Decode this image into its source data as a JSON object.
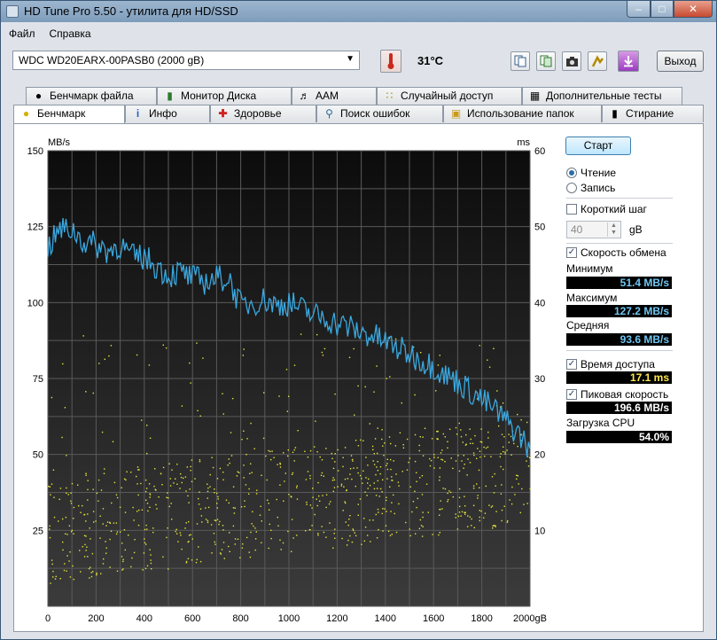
{
  "window": {
    "title": "HD Tune Pro 5.50 - утилита для HD/SSD"
  },
  "menu": {
    "file": "Файл",
    "help": "Справка"
  },
  "toolbar": {
    "drive": "WDC WD20EARX-00PASB0 (2000 gB)",
    "temperature": "31°C",
    "exit": "Выход",
    "icons": [
      "thermometer-icon",
      "copy-text-icon",
      "copy-image-icon",
      "camera-icon",
      "options-icon",
      "save-icon"
    ]
  },
  "tabs": {
    "row1": [
      "Бенчмарк файла",
      "Монитор Диска",
      "AAM",
      "Случайный доступ",
      "Дополнительные  тесты"
    ],
    "row2": [
      "Бенчмарк",
      "Инфо",
      "Здоровье",
      "Поиск ошибок",
      "Использование папок",
      "Стирание"
    ],
    "active": "Бенчмарк"
  },
  "side": {
    "start": "Старт",
    "read": "Чтение",
    "write": "Запись",
    "short_stroke": "Короткий шаг",
    "short_stroke_value": "40",
    "short_stroke_unit": "gB",
    "transfer_rate": "Скорость обмена",
    "minimum_label": "Минимум",
    "minimum": "51.4 MB/s",
    "maximum_label": "Максимум",
    "maximum": "127.2 MB/s",
    "average_label": "Средняя",
    "average": "93.6 MB/s",
    "access_time_label": "Время доступа",
    "access_time": "17.1 ms",
    "burst_label": "Пиковая скорость",
    "burst": "196.6 MB/s",
    "cpu_label": "Загрузка CPU",
    "cpu": "54.0%"
  },
  "chart_data": {
    "type": "line",
    "y_left_label": "MB/s",
    "y_right_label": "ms",
    "x_unit": "gB",
    "x_ticks": [
      "0",
      "200",
      "400",
      "600",
      "800",
      "1000",
      "1200",
      "1400",
      "1600",
      "1800",
      "2000gB"
    ],
    "y_left_ticks": [
      "25",
      "50",
      "75",
      "100",
      "125",
      "150"
    ],
    "y_right_ticks": [
      "10",
      "20",
      "30",
      "40",
      "50",
      "60"
    ],
    "xlim": [
      0,
      2000
    ],
    "ylim_left": [
      0,
      150
    ],
    "ylim_right": [
      0,
      60
    ],
    "colors": {
      "transfer": "#3aa8e0",
      "access": "#e6e63c",
      "background": "#1a1a1a"
    },
    "transfer_rate": {
      "x": [
        0,
        50,
        100,
        150,
        200,
        250,
        300,
        350,
        400,
        450,
        500,
        550,
        600,
        650,
        700,
        750,
        800,
        850,
        900,
        950,
        1000,
        1050,
        1100,
        1150,
        1200,
        1250,
        1300,
        1350,
        1400,
        1450,
        1500,
        1550,
        1600,
        1650,
        1700,
        1750,
        1800,
        1850,
        1900,
        1950,
        2000
      ],
      "y": [
        118,
        124,
        124,
        120,
        119,
        117,
        119,
        115,
        115,
        112,
        109,
        110,
        108,
        107,
        108,
        108,
        99,
        100,
        101,
        99,
        100,
        98,
        96,
        95,
        93,
        92,
        90,
        89,
        87,
        85,
        83,
        81,
        79,
        76,
        74,
        71,
        68,
        65,
        61,
        57,
        52
      ]
    },
    "access_time_scatter": "random access time points, ms (right axis), mostly 10–20 ms with outliers up to ~37 ms"
  }
}
